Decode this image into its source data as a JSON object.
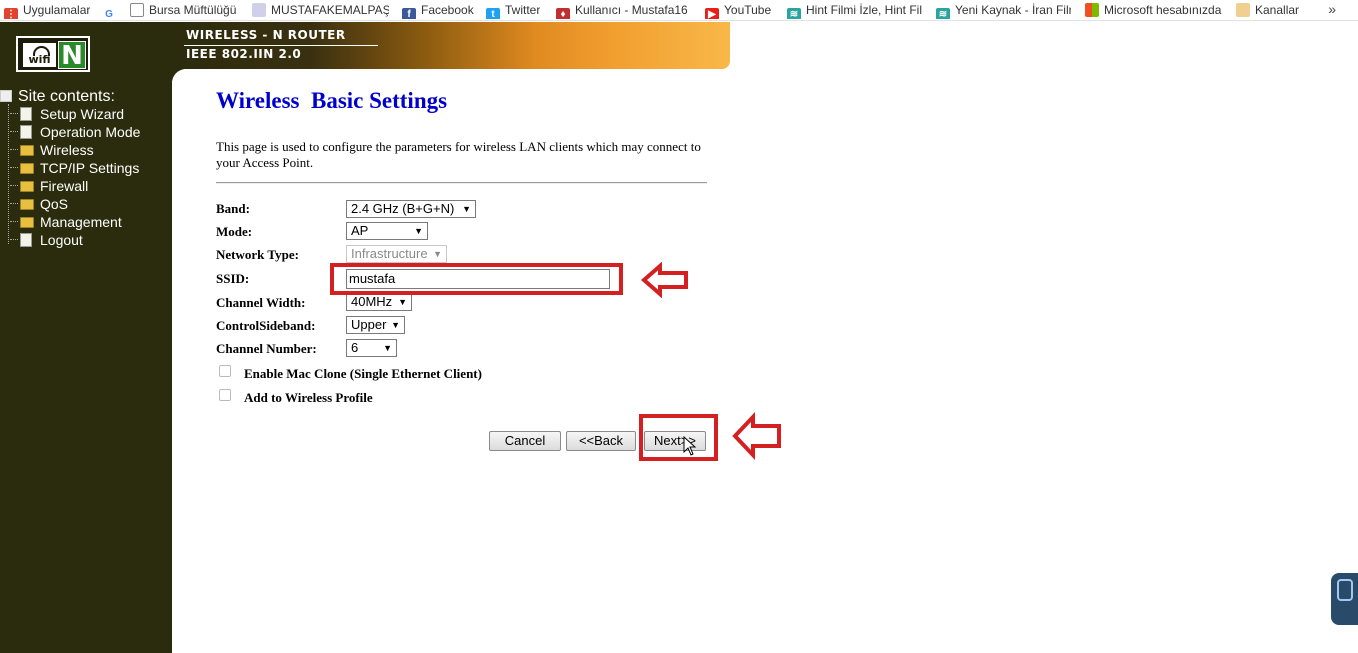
{
  "bookmarks": [
    {
      "label": "Uygulamalar",
      "icon": "apps-grid-icon",
      "color": "#e0442e"
    },
    {
      "label": "",
      "icon": "google-icon",
      "color": "#4285f4"
    },
    {
      "label": "Bursa Müftülüğü",
      "icon": "page-icon",
      "color": "#888888"
    },
    {
      "label": "MUSTAFAKEMALPAŞA",
      "icon": "site-icon",
      "color": "#d0d0e8"
    },
    {
      "label": "Facebook",
      "icon": "facebook-icon",
      "color": "#3b5998"
    },
    {
      "label": "Twitter",
      "icon": "twitter-icon",
      "color": "#1da1f2"
    },
    {
      "label": "Kullanıcı - Mustafa16 -",
      "icon": "user-icon",
      "color": "#c03030"
    },
    {
      "label": "YouTube",
      "icon": "youtube-icon",
      "color": "#e62117"
    },
    {
      "label": "Hint Filmi İzle, Hint Fil",
      "icon": "film-icon",
      "color": "#2aa4a0"
    },
    {
      "label": "Yeni Kaynak - İran Film",
      "icon": "film-icon",
      "color": "#2aa4a0"
    },
    {
      "label": "Microsoft hesabınızda",
      "icon": "microsoft-icon",
      "color": "#f25022"
    },
    {
      "label": "Kanallar",
      "icon": "folder-icon",
      "color": "#f0d090"
    }
  ],
  "bookmarks_more": "»",
  "logo": {
    "wifi": "wifi",
    "n": "N"
  },
  "banner": {
    "line1": "WIRELESS - N ROUTER",
    "line2": "IEEE 802.IIN 2.0"
  },
  "sidebar": {
    "header": "Site contents:",
    "items": [
      {
        "label": "Setup Wizard",
        "icon": "doc"
      },
      {
        "label": "Operation Mode",
        "icon": "doc"
      },
      {
        "label": "Wireless",
        "icon": "folder"
      },
      {
        "label": "TCP/IP Settings",
        "icon": "folder"
      },
      {
        "label": "Firewall",
        "icon": "folder"
      },
      {
        "label": "QoS",
        "icon": "folder"
      },
      {
        "label": "Management",
        "icon": "folder"
      },
      {
        "label": "Logout",
        "icon": "doc"
      }
    ]
  },
  "page": {
    "title": "Wireless  Basic Settings",
    "description": "This page is used to configure the parameters for wireless LAN clients which may connect to your Access Point."
  },
  "form": {
    "band": {
      "label": "Band:",
      "value": "2.4 GHz (B+G+N)"
    },
    "mode": {
      "label": "Mode:",
      "value": "AP"
    },
    "network_type": {
      "label": "Network Type:",
      "value": "Infrastructure"
    },
    "ssid": {
      "label": "SSID:",
      "value": "mustafa"
    },
    "channel_width": {
      "label": "Channel Width:",
      "value": "40MHz"
    },
    "control_sideband": {
      "label": "ControlSideband:",
      "value": "Upper"
    },
    "channel_number": {
      "label": "Channel Number:",
      "value": "6"
    },
    "mac_clone": {
      "label": "Enable Mac Clone (Single Ethernet Client)",
      "checked": false
    },
    "wireless_profile": {
      "label": "Add to Wireless Profile",
      "checked": false
    }
  },
  "buttons": {
    "cancel": "Cancel",
    "back": "<<Back",
    "next": "Next>>"
  },
  "colors": {
    "title_blue": "#0000cc",
    "sidebar_bg": "#2b2b0d",
    "highlight_red": "#d42020"
  }
}
